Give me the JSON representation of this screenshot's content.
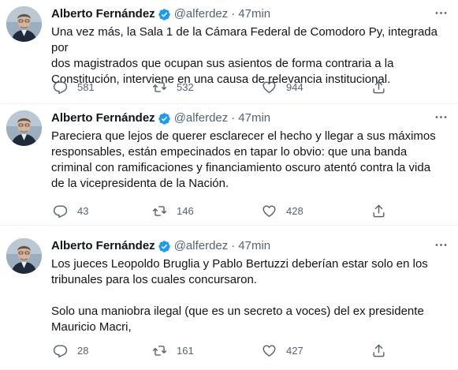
{
  "tweets": [
    {
      "author": "Alberto Fernández",
      "handle": "@alferdez",
      "separator": "·",
      "time": "47min",
      "text": "Una vez más, la Sala 1 de la Cámara Federal de Comodoro Py, integrada por\ndos magistrados que ocupan sus asientos de forma contraria a la\nConstitución, interviene en una causa de relevancia institucional.",
      "replies": "581",
      "retweets": "532",
      "likes": "944"
    },
    {
      "author": "Alberto Fernández",
      "handle": "@alferdez",
      "separator": "·",
      "time": "47min",
      "text": "Pareciera que lejos de querer esclarecer el hecho y llegar a sus máximos\nresponsables, están empecinados en tapar lo obvio: que una banda\ncriminal con ramificaciones y financiamiento oscuro atentó contra la vida\nde la vicepresidenta de la Nación.",
      "replies": "43",
      "retweets": "146",
      "likes": "428"
    },
    {
      "author": "Alberto Fernández",
      "handle": "@alferdez",
      "separator": "·",
      "time": "47min",
      "text": "Los jueces Leopoldo Bruglia y Pablo Bertuzzi deberían estar solo en los\ntribunales para los cuales concursaron.\n\nSolo una maniobra ilegal (que es un secreto a voces) del ex presidente\nMauricio Macri,",
      "replies": "28",
      "retweets": "161",
      "likes": "427"
    }
  ],
  "icons": {
    "verified": "verified-badge-icon",
    "more": "more-icon",
    "reply": "reply-icon",
    "retweet": "retweet-icon",
    "like": "heart-icon",
    "share": "share-icon"
  },
  "colors": {
    "verified": "#1d9bf0",
    "secondary_text": "#536471",
    "primary_text": "#0f1419",
    "divider": "#eff3f4"
  }
}
